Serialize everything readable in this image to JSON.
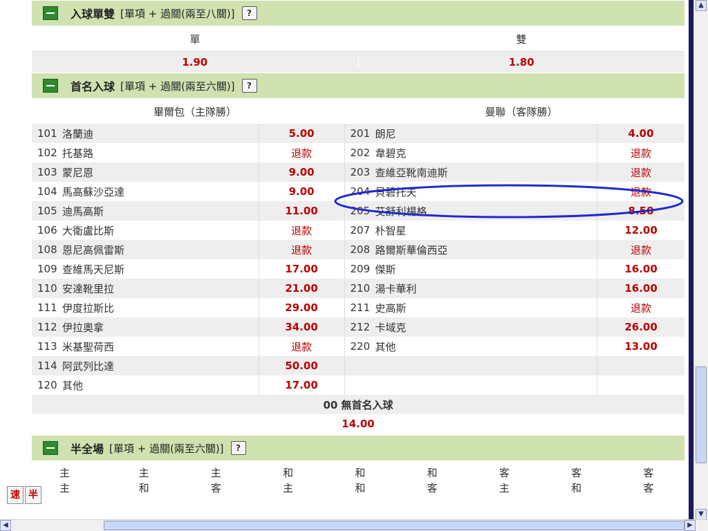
{
  "colors": {
    "header_bg": "#cfe2b0",
    "odds_red": "#b00000",
    "row_alt": "#eeeeee",
    "annotation": "#1e2ad0"
  },
  "oddeven": {
    "title": "入球單雙",
    "subtitle": "[單項 + 過關(兩至八關)]",
    "help": "?",
    "col_odd": "單",
    "col_even": "雙",
    "odd_value": "1.90",
    "even_value": "1.80"
  },
  "firstscorer": {
    "title": "首名入球",
    "subtitle": "[單項 + 過關(兩至六關)]",
    "help": "?",
    "home_header": "畢爾包（主隊勝）",
    "away_header": "曼聯（客隊勝）",
    "home": [
      {
        "no": "101",
        "name": "洛蘭迪",
        "odds": "5.00"
      },
      {
        "no": "102",
        "name": "托基路",
        "odds": "退款"
      },
      {
        "no": "103",
        "name": "蒙尼恩",
        "odds": "9.00"
      },
      {
        "no": "104",
        "name": "馬高蘇沙亞達",
        "odds": "9.00"
      },
      {
        "no": "105",
        "name": "迪馬高斯",
        "odds": "11.00"
      },
      {
        "no": "106",
        "name": "大衛盧比斯",
        "odds": "退款"
      },
      {
        "no": "108",
        "name": "恩尼高佩雷斯",
        "odds": "退款"
      },
      {
        "no": "109",
        "name": "查維馬天尼斯",
        "odds": "17.00"
      },
      {
        "no": "110",
        "name": "安達靴里拉",
        "odds": "21.00"
      },
      {
        "no": "111",
        "name": "伊度拉斯比",
        "odds": "29.00"
      },
      {
        "no": "112",
        "name": "伊拉奧拿",
        "odds": "34.00"
      },
      {
        "no": "113",
        "name": "米基聖荷西",
        "odds": "退款"
      },
      {
        "no": "114",
        "name": "阿武列比達",
        "odds": "50.00"
      },
      {
        "no": "120",
        "name": "其他",
        "odds": "17.00"
      }
    ],
    "away": [
      {
        "no": "201",
        "name": "朗尼",
        "odds": "4.00"
      },
      {
        "no": "202",
        "name": "韋碧克",
        "odds": "退款"
      },
      {
        "no": "203",
        "name": "查維亞靴南迪斯",
        "odds": "退款"
      },
      {
        "no": "204",
        "name": "貝碧托夫",
        "odds": "退款"
      },
      {
        "no": "205",
        "name": "艾舒利楊格",
        "odds": "8.50"
      },
      {
        "no": "207",
        "name": "朴智星",
        "odds": "12.00"
      },
      {
        "no": "208",
        "name": "路爾斯華倫西亞",
        "odds": "退款"
      },
      {
        "no": "209",
        "name": "傑斯",
        "odds": "16.00"
      },
      {
        "no": "210",
        "name": "湯卡華利",
        "odds": "16.00"
      },
      {
        "no": "211",
        "name": "史高斯",
        "odds": "退款"
      },
      {
        "no": "212",
        "name": "卡域克",
        "odds": "26.00"
      },
      {
        "no": "220",
        "name": "其他",
        "odds": "13.00"
      },
      {
        "no": "",
        "name": "",
        "odds": ""
      },
      {
        "no": "",
        "name": "",
        "odds": ""
      }
    ],
    "no_first_label": "00  無首名入球",
    "no_first_odds": "14.00"
  },
  "halffull": {
    "title": "半全場",
    "subtitle": "[單項 + 過關(兩至六關)]",
    "help": "?",
    "columns": [
      [
        "主",
        "主"
      ],
      [
        "主",
        "和"
      ],
      [
        "主",
        "客"
      ],
      [
        "和",
        "主"
      ],
      [
        "和",
        "和"
      ],
      [
        "和",
        "客"
      ],
      [
        "客",
        "主"
      ],
      [
        "客",
        "和"
      ],
      [
        "客",
        "客"
      ]
    ]
  },
  "quicktags": [
    "速",
    "半"
  ]
}
